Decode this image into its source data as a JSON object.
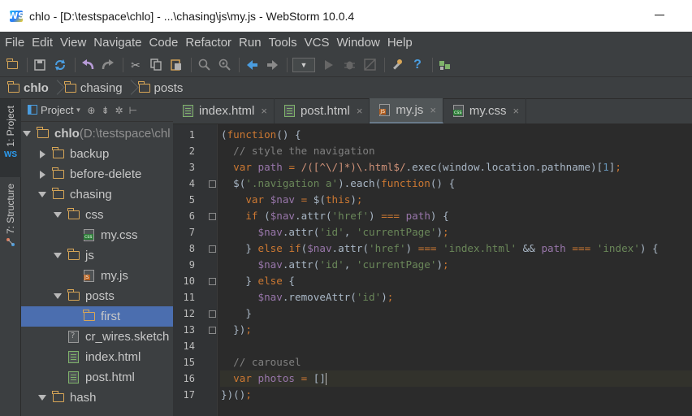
{
  "window": {
    "app_logo": "WS",
    "title": "chlo - [D:\\testspace\\chlo] - ...\\chasing\\js\\my.js - WebStorm 10.0.4"
  },
  "menu": [
    "File",
    "Edit",
    "View",
    "Navigate",
    "Code",
    "Refactor",
    "Run",
    "Tools",
    "VCS",
    "Window",
    "Help"
  ],
  "toolbar_icons": [
    "open-folder-icon",
    "save-icon",
    "sync-icon",
    "undo-icon",
    "redo-icon",
    "cut-icon",
    "copy-icon",
    "paste-icon",
    "find-icon",
    "replace-icon",
    "back-icon",
    "forward-icon",
    "run-config-dropdown",
    "run-icon",
    "debug-icon",
    "coverage-icon",
    "settings-icon",
    "help-icon",
    "terminal-icon"
  ],
  "breadcrumb": [
    "chlo",
    "chasing",
    "posts"
  ],
  "side_tabs": [
    "1: Project",
    "7: Structure"
  ],
  "project_panel": {
    "view_label": "Project"
  },
  "tree": [
    {
      "label": "chlo",
      "suffix": " (D:\\testspace\\chl",
      "type": "folder",
      "expanded": true,
      "depth": 0
    },
    {
      "label": "backup",
      "type": "folder",
      "expanded": false,
      "depth": 1
    },
    {
      "label": "before-delete",
      "type": "folder",
      "expanded": false,
      "depth": 1
    },
    {
      "label": "chasing",
      "type": "folder",
      "expanded": true,
      "depth": 1
    },
    {
      "label": "css",
      "type": "folder",
      "expanded": true,
      "depth": 2
    },
    {
      "label": "my.css",
      "type": "css",
      "depth": 3
    },
    {
      "label": "js",
      "type": "folder",
      "expanded": true,
      "depth": 2
    },
    {
      "label": "my.js",
      "type": "js",
      "depth": 3
    },
    {
      "label": "posts",
      "type": "folder",
      "expanded": true,
      "depth": 2
    },
    {
      "label": "first",
      "type": "folder",
      "depth": 3,
      "selected": true
    },
    {
      "label": "cr_wires.sketch",
      "type": "unknown",
      "depth": 2
    },
    {
      "label": "index.html",
      "type": "html",
      "depth": 2
    },
    {
      "label": "post.html",
      "type": "html",
      "depth": 2
    },
    {
      "label": "hash",
      "type": "folder",
      "expanded": true,
      "depth": 1
    }
  ],
  "tabs": [
    {
      "label": "index.html",
      "type": "html",
      "active": false
    },
    {
      "label": "post.html",
      "type": "html",
      "active": false
    },
    {
      "label": "my.js",
      "type": "js",
      "active": true
    },
    {
      "label": "my.css",
      "type": "css",
      "active": false
    }
  ],
  "tab_close_glyph": "×",
  "editor": {
    "current_line": 16,
    "line_numbers": [
      "1",
      "2",
      "3",
      "4",
      "5",
      "6",
      "7",
      "8",
      "9",
      "10",
      "11",
      "12",
      "13",
      "14",
      "15",
      "16",
      "17"
    ],
    "lines": [
      "(function() {",
      "  // style the navigation",
      "  var path = /([^\\/]*)\\.html$/.exec(window.location.pathname)[1];",
      "  $('.navigation a').each(function() {",
      "    var $nav = $(this);",
      "    if ($nav.attr('href') === path) {",
      "      $nav.attr('id', 'currentPage');",
      "    } else if($nav.attr('href') === 'index.html' && path === 'index') {",
      "      $nav.attr('id', 'currentPage');",
      "    } else {",
      "      $nav.removeAttr('id');",
      "    }",
      "  });",
      "",
      "  // carousel",
      "  var photos = []",
      "})();"
    ]
  },
  "colors": {
    "keyword": "#cc7832",
    "string": "#6a8759",
    "comment": "#808080",
    "selection": "#4b6eaf",
    "background": "#2b2b2b"
  }
}
